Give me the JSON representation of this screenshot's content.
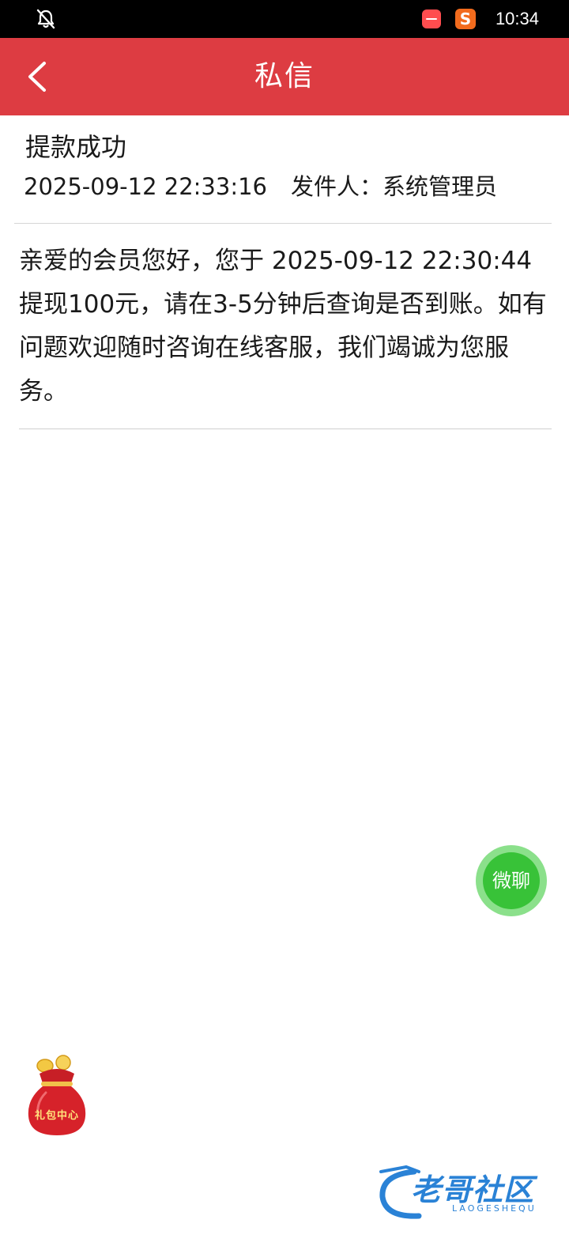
{
  "status_bar": {
    "time": "10:34",
    "icons": [
      "notifications-off-icon",
      "app-icon-red",
      "sogou-app-icon"
    ],
    "sogou_glyph": "S"
  },
  "header": {
    "title": "私信",
    "back_icon": "chevron-left-icon",
    "background_color": "#dd3c42"
  },
  "message": {
    "subject": "提款成功",
    "datetime": "2025-09-12 22:33:16",
    "sender_label": "发件人：",
    "sender": "系统管理员",
    "body": "亲爱的会员您好，您于 2025-09-12 22:30:44 提现100元，请在3-5分钟后查询是否到账。如有问题欢迎随时咨询在线客服，我们竭诚为您服务。"
  },
  "floating": {
    "chat_label": "微聊",
    "gift_label": "礼包中心"
  },
  "watermark": {
    "text": "老哥社区",
    "subtext": "LAOGESHEQU"
  }
}
